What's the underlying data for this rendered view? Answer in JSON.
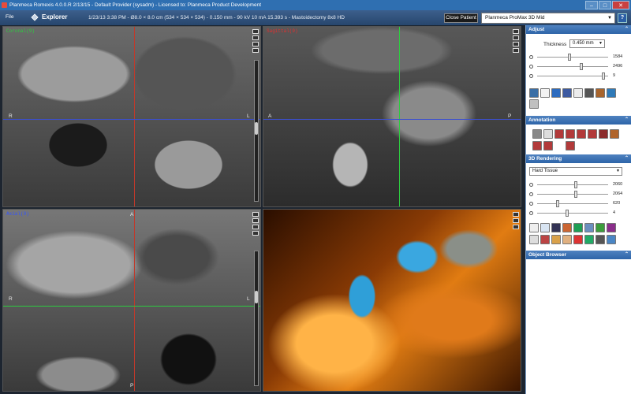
{
  "window": {
    "title": "Planmeca Romexis 4.0.0.R  2/13/15 - Default Provider (sysadm) - Licensed to: Planmeca Product Development",
    "min": "–",
    "max": "□",
    "close": "✕"
  },
  "header": {
    "file_menu": "File",
    "explorer": "Explorer",
    "patient_info": "1/23/13 3:38 PM - Ø8.0 × 8.0 cm (534 × 534 × 534) - 0.150 mm - 90 kV 10 mA 15.393 s - Mastoidectomy 8x8 HD",
    "close_patient": "Close Patient",
    "device": "Planmeca ProMax 3D Mid",
    "help": "?"
  },
  "viewports": {
    "coronal": {
      "label": "Coronal(9)",
      "left": "R",
      "right": "L",
      "label_color": "#2ecc40"
    },
    "sagittal": {
      "label": "Sagittal(9)",
      "left": "A",
      "right": "P",
      "label_color": "#e03030"
    },
    "axial": {
      "label": "Axial(9)",
      "top": "A",
      "bottom": "P",
      "left": "R",
      "right": "L",
      "label_color": "#3355ff"
    }
  },
  "panel": {
    "adjust": {
      "title": "Adjust",
      "collapse": "⌃",
      "thickness_label": "Thickness",
      "thickness_value": "0.450 mm",
      "sliders": [
        {
          "value": "1584",
          "level": 0.45
        },
        {
          "value": "2496",
          "level": 0.63
        },
        {
          "value": "9",
          "level": 0.95
        }
      ]
    },
    "annotation": {
      "title": "Annotation",
      "collapse": "⌃"
    },
    "rendering": {
      "title": "3D Rendering",
      "collapse": "⌃",
      "preset": "Hard Tissue",
      "sliders": [
        {
          "value": "2060",
          "level": 0.55
        },
        {
          "value": "2064",
          "level": 0.55
        },
        {
          "value": "620",
          "level": 0.28
        },
        {
          "value": "4",
          "level": 0.42
        }
      ]
    },
    "object_browser": {
      "title": "Object Browser",
      "collapse": "⌃"
    }
  }
}
